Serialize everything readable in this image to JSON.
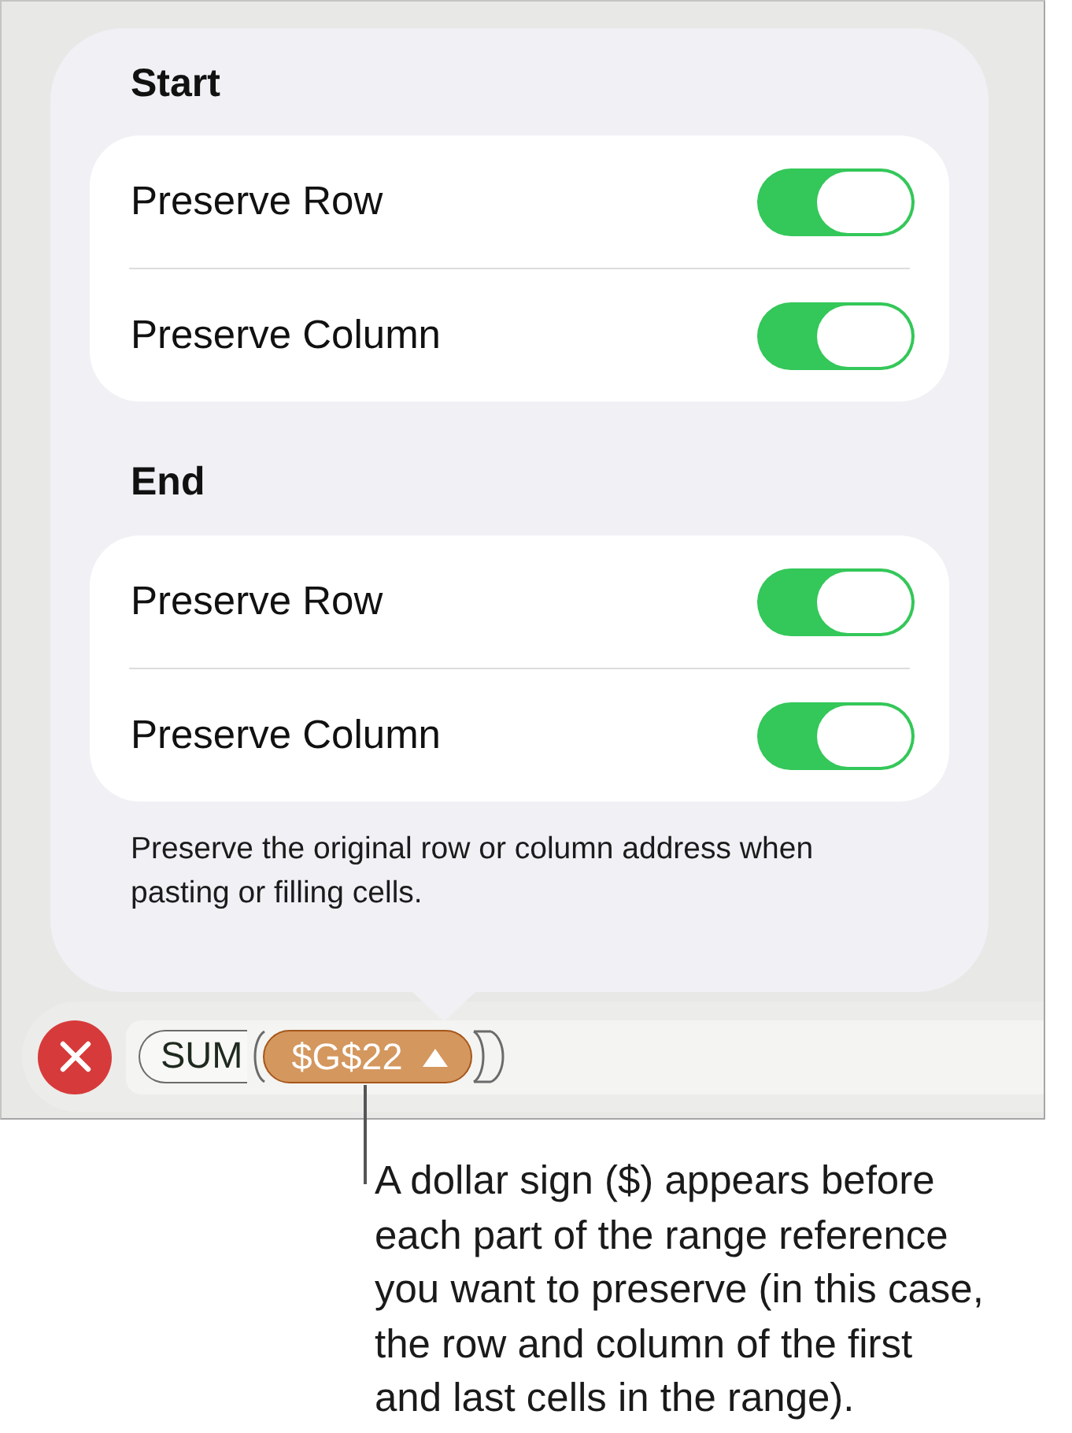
{
  "popover": {
    "sections": [
      {
        "heading": "Start",
        "rows": [
          {
            "label": "Preserve Row",
            "on": true
          },
          {
            "label": "Preserve Column",
            "on": true
          }
        ]
      },
      {
        "heading": "End",
        "rows": [
          {
            "label": "Preserve Row",
            "on": true
          },
          {
            "label": "Preserve Column",
            "on": true
          }
        ]
      }
    ],
    "footnote": "Preserve the original row or column address when pasting or filling cells."
  },
  "formula_bar": {
    "function": "SUM",
    "arguments": [
      {
        "text": "$G$22",
        "selected": true
      }
    ]
  },
  "callout": {
    "lines": [
      "A dollar sign ($) appears before",
      "each part of the range reference",
      "you want to preserve (in this case,",
      "the row and column of the first",
      "and last cells in the range)."
    ]
  }
}
